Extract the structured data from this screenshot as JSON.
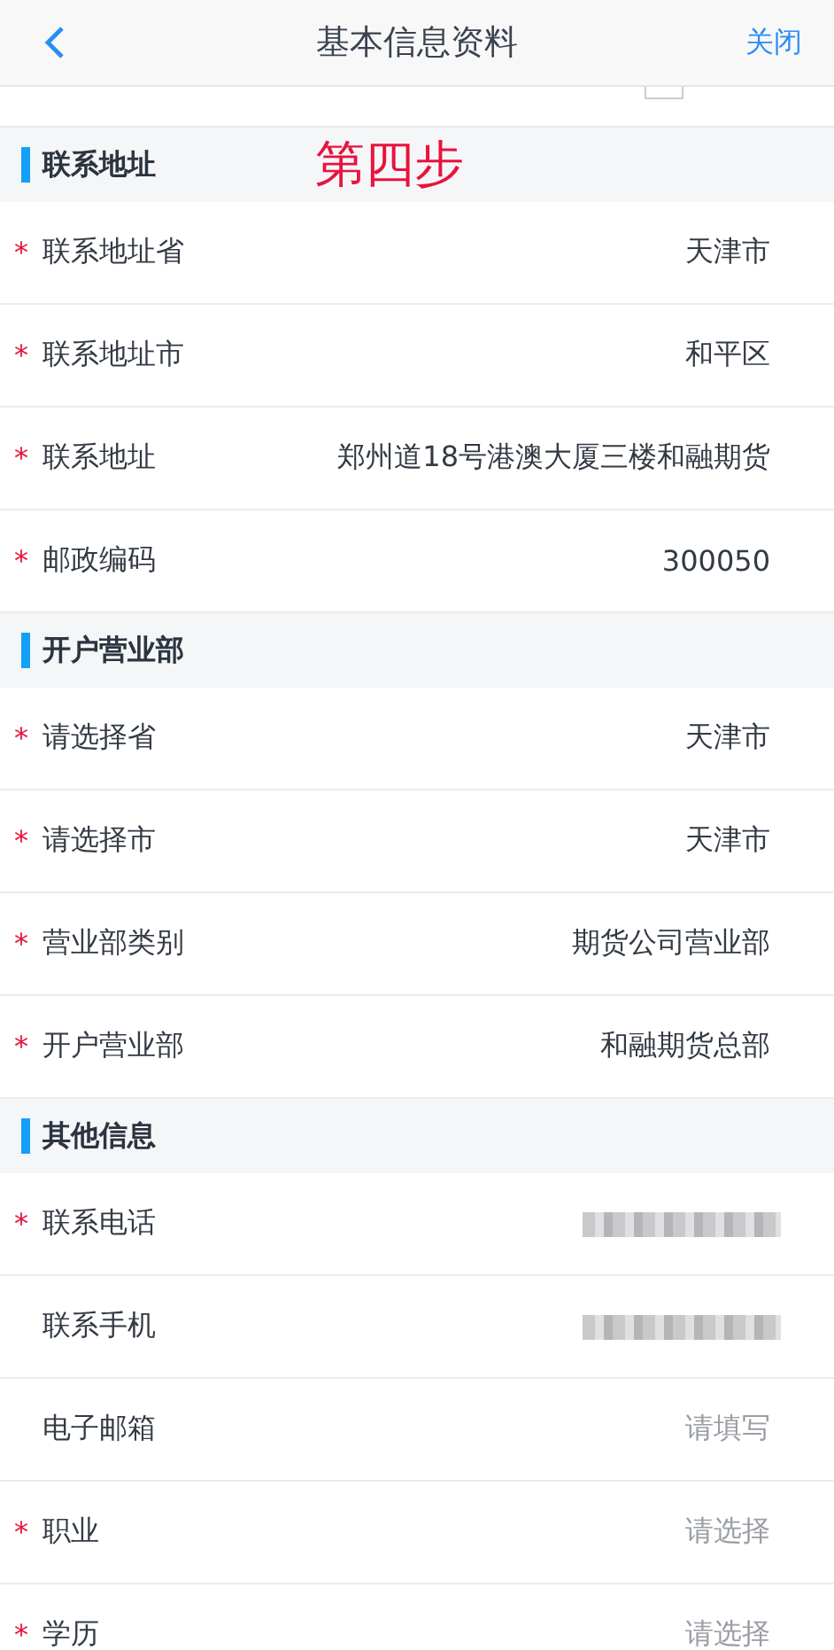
{
  "header": {
    "title": "基本信息资料",
    "close": "关闭"
  },
  "required_symbol": "*",
  "sections": [
    {
      "title": "联系地址",
      "annotation": "第四步",
      "rows": [
        {
          "label": "联系地址省",
          "required": true,
          "kind": "value",
          "value": "天津市"
        },
        {
          "label": "联系地址市",
          "required": true,
          "kind": "value",
          "value": "和平区"
        },
        {
          "label": "联系地址",
          "required": true,
          "kind": "value",
          "value": "郑州道18号港澳大厦三楼和融期货"
        },
        {
          "label": "邮政编码",
          "required": true,
          "kind": "value",
          "value": "300050"
        }
      ]
    },
    {
      "title": "开户营业部",
      "rows": [
        {
          "label": "请选择省",
          "required": true,
          "kind": "value",
          "value": "天津市"
        },
        {
          "label": "请选择市",
          "required": true,
          "kind": "value",
          "value": "天津市"
        },
        {
          "label": "营业部类别",
          "required": true,
          "kind": "value",
          "value": "期货公司营业部"
        },
        {
          "label": "开户营业部",
          "required": true,
          "kind": "value",
          "value": "和融期货总部"
        }
      ]
    },
    {
      "title": "其他信息",
      "rows": [
        {
          "label": "联系电话",
          "required": true,
          "kind": "redacted"
        },
        {
          "label": "联系手机",
          "required": false,
          "kind": "redacted"
        },
        {
          "label": "电子邮箱",
          "required": false,
          "kind": "input",
          "placeholder": "请填写"
        },
        {
          "label": "职业",
          "required": true,
          "kind": "select",
          "placeholder": "请选择"
        },
        {
          "label": "学历",
          "required": true,
          "kind": "select",
          "placeholder": "请选择"
        }
      ]
    }
  ]
}
